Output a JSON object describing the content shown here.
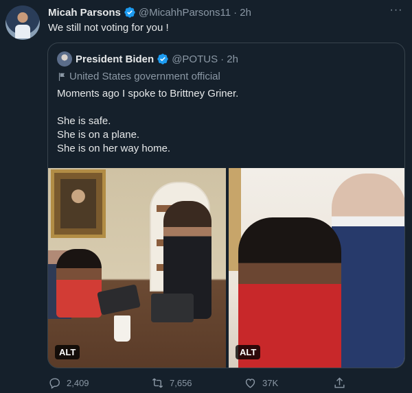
{
  "tweet": {
    "author_name": "Micah Parsons",
    "handle": "@MicahhParsons11",
    "time": "· 2h",
    "text": "We still not voting for you !",
    "more_icon": "more-icon"
  },
  "quoted": {
    "author_name": "President Biden",
    "handle": "@POTUS",
    "time": "· 2h",
    "label": "United States government official",
    "lines": [
      "Moments ago I spoke to Brittney Griner.",
      "",
      "She is safe.",
      "She is on a plane.",
      "She is on her way home."
    ],
    "media": [
      {
        "alt": "ALT"
      },
      {
        "alt": "ALT"
      }
    ]
  },
  "actions": {
    "replies": "2,409",
    "retweets": "7,656",
    "likes": "37K"
  },
  "colors": {
    "background": "#15202b",
    "text": "#e7e9ea",
    "muted": "#8b98a5",
    "verified": "#1d9bf0",
    "border": "#38444d"
  }
}
